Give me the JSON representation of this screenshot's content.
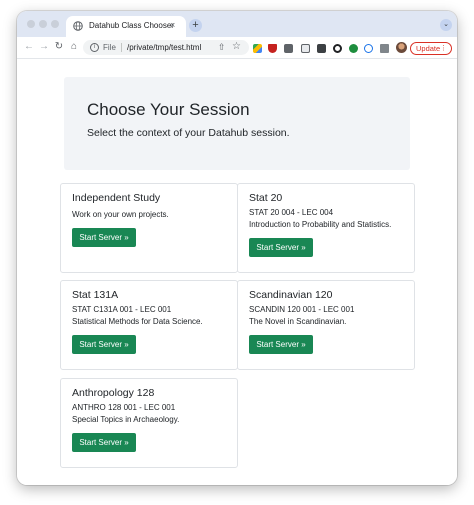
{
  "browser": {
    "tab_title": "Datahub Class Chooser",
    "tab_close": "×",
    "new_tab": "+",
    "tab_menu": "⌄",
    "back": "←",
    "forward": "→",
    "reload": "↻",
    "home": "⌂",
    "scheme_label": "File",
    "url": "/private/tmp/test.html",
    "update_label": "Update",
    "menu_dots": "⋮"
  },
  "hero": {
    "title": "Choose Your Session",
    "subtitle": "Select the context of your Datahub session."
  },
  "sessions": [
    {
      "title": "Independent Study",
      "lines": [
        "Work on your own projects."
      ],
      "button": "Start Server »"
    },
    {
      "title": "Stat 20",
      "lines": [
        "STAT 20 004 - LEC 004",
        "Introduction to Probability and Statistics."
      ],
      "button": "Start Server »"
    },
    {
      "title": "Stat 131A",
      "lines": [
        "STAT C131A 001 - LEC 001",
        "Statistical Methods for Data Science."
      ],
      "button": "Start Server »"
    },
    {
      "title": "Scandinavian 120",
      "lines": [
        "SCANDIN 120 001 - LEC 001",
        "The Novel in Scandinavian."
      ],
      "button": "Start Server »"
    },
    {
      "title": "Anthropology 128",
      "lines": [
        "ANTHRO 128 001 - LEC 001",
        "Special Topics in Archaeology."
      ],
      "button": "Start Server »"
    }
  ],
  "colors": {
    "button_green": "#198754",
    "hero_background": "#f2f4f7",
    "update_red": "#d93025"
  }
}
